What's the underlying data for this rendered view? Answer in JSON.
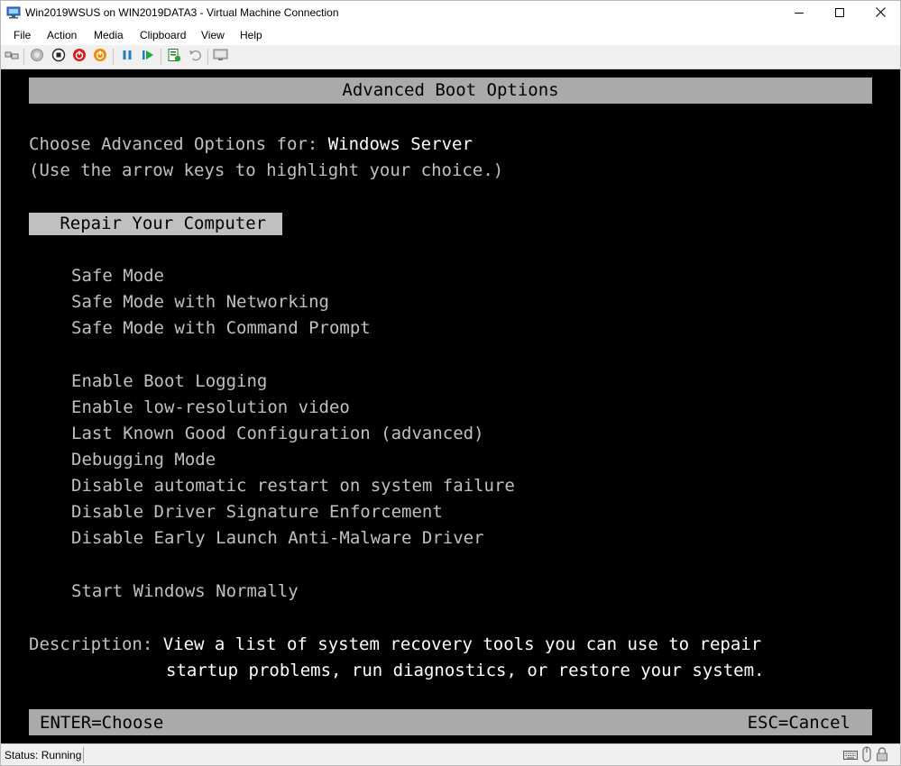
{
  "window": {
    "title": "Win2019WSUS on WIN2019DATA3 - Virtual Machine Connection",
    "icon": "vm-connection-icon",
    "controls": {
      "minimize": "minimize-icon",
      "maximize": "maximize-icon",
      "close": "close-icon"
    }
  },
  "menu": {
    "items": [
      {
        "label": "File"
      },
      {
        "label": "Action"
      },
      {
        "label": "Media"
      },
      {
        "label": "Clipboard"
      },
      {
        "label": "View"
      },
      {
        "label": "Help"
      }
    ]
  },
  "toolbar": {
    "buttons": [
      {
        "icon": "ctrl-alt-del-icon"
      },
      {
        "icon": "start-icon"
      },
      {
        "icon": "turn-off-icon"
      },
      {
        "icon": "shut-down-icon"
      },
      {
        "icon": "power-icon"
      },
      {
        "icon": "pause-icon"
      },
      {
        "icon": "resume-icon"
      },
      {
        "icon": "checkpoint-icon"
      },
      {
        "icon": "revert-icon"
      },
      {
        "icon": "enhanced-session-icon"
      }
    ]
  },
  "console": {
    "header": "Advanced Boot Options",
    "choose_label": "Choose Advanced Options for: ",
    "choose_os": "Windows Server",
    "instructions": "(Use the arrow keys to highlight your choice.)",
    "selected_option": "   Repair Your Computer",
    "options_group1": [
      "Safe Mode",
      "Safe Mode with Networking",
      "Safe Mode with Command Prompt"
    ],
    "options_group2": [
      "Enable Boot Logging",
      "Enable low-resolution video",
      "Last Known Good Configuration (advanced)",
      "Debugging Mode",
      "Disable automatic restart on system failure",
      "Disable Driver Signature Enforcement",
      "Disable Early Launch Anti-Malware Driver"
    ],
    "options_group3": [
      "Start Windows Normally"
    ],
    "description_label": "Description: ",
    "description_line1": "View a list of system recovery tools you can use to repair",
    "description_line2": "startup problems, run diagnostics, or restore your system.",
    "footer_left": "ENTER=Choose",
    "footer_right": "ESC=Cancel"
  },
  "status": {
    "text": "Status: Running",
    "icons": [
      "keyboard-icon",
      "mouse-icon",
      "lock-icon"
    ]
  }
}
